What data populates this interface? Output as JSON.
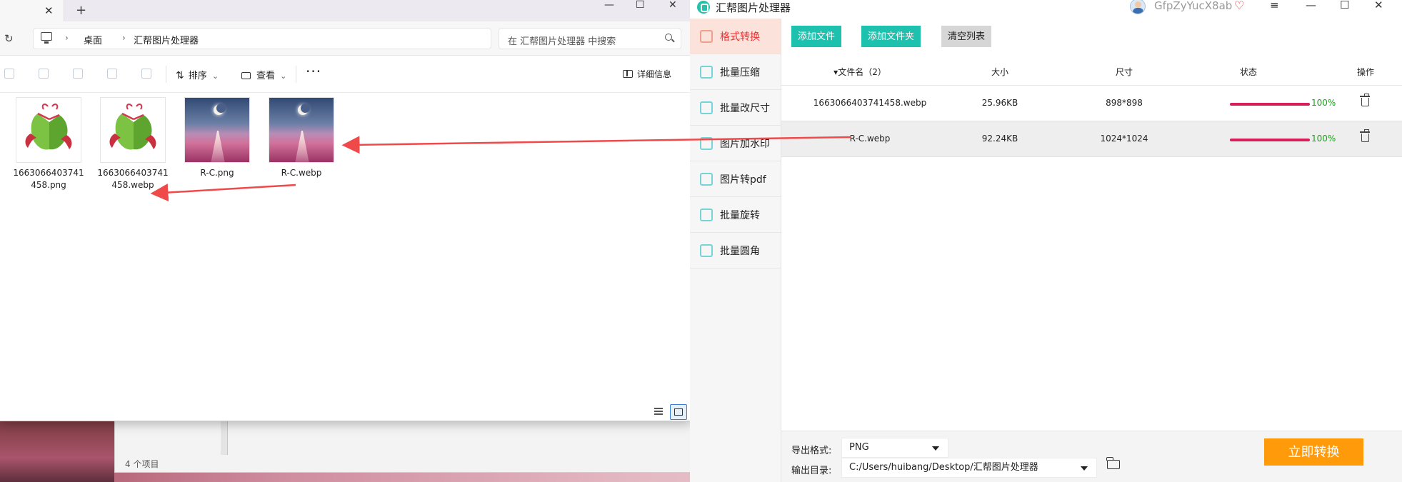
{
  "explorer": {
    "tab_close": "✕",
    "new_tab": "+",
    "window_controls": {
      "minimize": "—",
      "maximize": "☐",
      "close": "✕"
    },
    "refresh": "↻",
    "breadcrumb": {
      "sep": "›",
      "items": [
        "桌面",
        "汇帮图片处理器"
      ]
    },
    "search_placeholder": "在 汇帮图片处理器 中搜索",
    "toolbar": {
      "sort": "排序",
      "view": "查看",
      "more": "···",
      "details": "详细信息",
      "sort_icon": "⇅",
      "dropdown": "⌄"
    },
    "files": [
      {
        "name": "1663066403741458.png",
        "thumb": "zongzi-icon"
      },
      {
        "name": "1663066403741458.webp",
        "thumb": "zongzi-icon"
      },
      {
        "name": "R-C.png",
        "thumb": "moon-sea-image"
      },
      {
        "name": "R-C.webp",
        "thumb": "moon-sea-image"
      }
    ],
    "status_count": "4 个项目"
  },
  "app": {
    "title": "汇帮图片处理器",
    "user": "GfpZyYucX8ab",
    "vip_icon": "♡",
    "window_controls": {
      "menu": "≡",
      "minimize": "—",
      "maximize": "☐",
      "close": "✕"
    },
    "sidebar": [
      {
        "label": "格式转换",
        "icon": "convert-icon",
        "active": true
      },
      {
        "label": "批量压缩",
        "icon": "compress-icon",
        "active": false
      },
      {
        "label": "批量改尺寸",
        "icon": "resize-icon",
        "active": false
      },
      {
        "label": "图片加水印",
        "icon": "watermark-icon",
        "active": false
      },
      {
        "label": "图片转pdf",
        "icon": "pdf-icon",
        "active": false
      },
      {
        "label": "批量旋转",
        "icon": "rotate-icon",
        "active": false
      },
      {
        "label": "批量圆角",
        "icon": "round-corner-icon",
        "active": false
      }
    ],
    "buttons": {
      "add_file": "添加文件",
      "add_folder": "添加文件夹",
      "clear_list": "清空列表"
    },
    "table": {
      "headers": {
        "name": "▾文件名（2）",
        "size": "大小",
        "dims": "尺寸",
        "status": "状态",
        "action": "操作"
      },
      "rows": [
        {
          "name": "1663066403741458.webp",
          "size": "25.96KB",
          "dims": "898*898",
          "progress": "100%",
          "selected": false
        },
        {
          "name": "R-C.webp",
          "size": "92.24KB",
          "dims": "1024*1024",
          "progress": "100%",
          "selected": true
        }
      ]
    },
    "footer": {
      "format_label": "导出格式:",
      "format_value": "PNG",
      "dir_label": "输出目录:",
      "dir_value": "C:/Users/huibang/Desktop/汇帮图片处理器",
      "convert": "立即转换"
    }
  },
  "colors": {
    "accent_teal": "#1ec1ad",
    "active_red": "#ea2e2e",
    "progress_bar": "#d81f5a",
    "progress_text": "#18a418",
    "convert_orange": "#ff9b0a",
    "arrow_red": "#f04949"
  }
}
